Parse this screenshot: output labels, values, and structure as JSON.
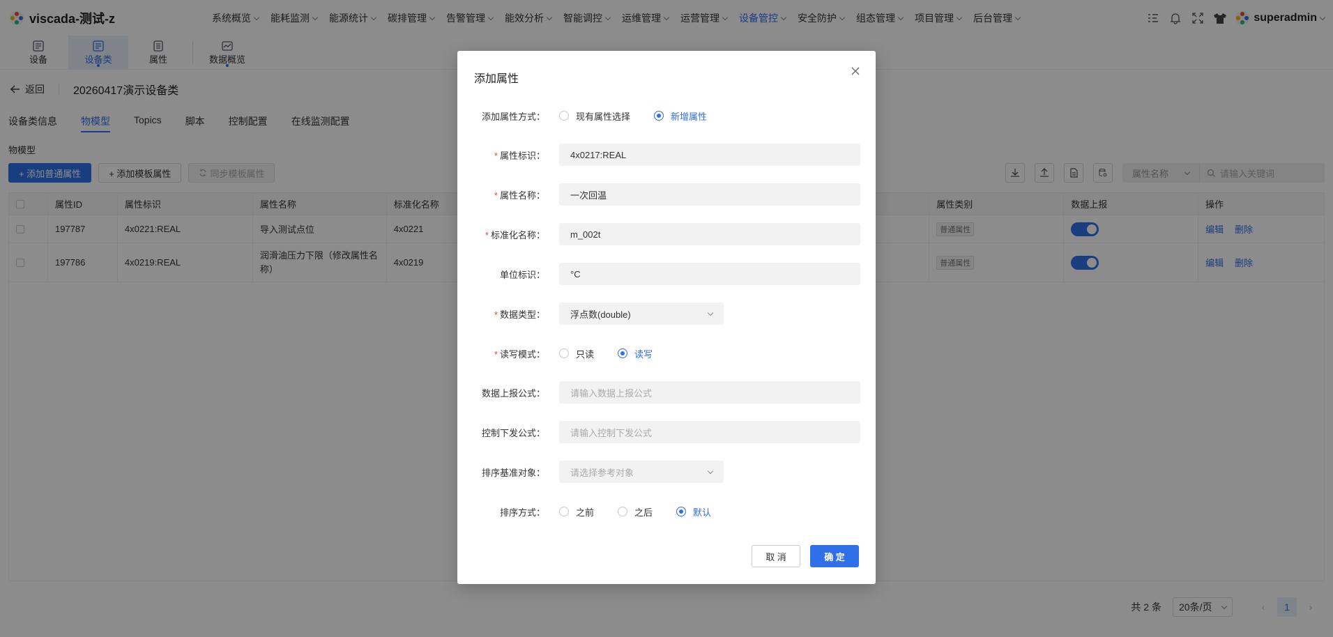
{
  "app": {
    "title": "viscada-测试-z"
  },
  "topnav": [
    {
      "label": "系统概览"
    },
    {
      "label": "能耗监测"
    },
    {
      "label": "能源统计"
    },
    {
      "label": "碳排管理"
    },
    {
      "label": "告警管理"
    },
    {
      "label": "能效分析"
    },
    {
      "label": "智能调控"
    },
    {
      "label": "运维管理"
    },
    {
      "label": "运营管理"
    },
    {
      "label": "设备管控"
    },
    {
      "label": "安全防护"
    },
    {
      "label": "组态管理"
    },
    {
      "label": "项目管理"
    },
    {
      "label": "后台管理"
    }
  ],
  "topnav_active": "设备管控",
  "user": {
    "name": "superadmin"
  },
  "subnav": [
    {
      "label": "设备"
    },
    {
      "label": "设备类"
    },
    {
      "label": "属性"
    },
    {
      "label": "数据概览"
    }
  ],
  "breadcrumb": {
    "back": "返回",
    "title": "20260417演示设备类"
  },
  "tabs": [
    {
      "label": "设备类信息"
    },
    {
      "label": "物模型"
    },
    {
      "label": "Topics"
    },
    {
      "label": "脚本"
    },
    {
      "label": "控制配置"
    },
    {
      "label": "在线监测配置"
    }
  ],
  "section_title": "物模型",
  "toolbar": {
    "add_normal": "+ 添加普通属性",
    "add_template": "+ 添加模板属性",
    "sync_template": "同步模板属性",
    "filter_select": "属性名称",
    "search_placeholder": "请输入关键词"
  },
  "table": {
    "headers": {
      "id": "属性ID",
      "ident": "属性标识",
      "name": "属性名称",
      "std": "标准化名称",
      "category": "属性类别",
      "report": "数据上报",
      "ops": "操作"
    },
    "rows": [
      {
        "id": "197787",
        "ident": "4x0221:REAL",
        "name": "导入测试点位",
        "std": "4x0221",
        "category": "普通属性",
        "report": true,
        "edit": "编辑",
        "del": "删除"
      },
      {
        "id": "197786",
        "ident": "4x0219:REAL",
        "name": "润滑油压力下限（修改属性名称）",
        "std": "4x0219",
        "category": "普通属性",
        "report": true,
        "edit": "编辑",
        "del": "删除"
      }
    ]
  },
  "pagination": {
    "total": "共 2 条",
    "page_size": "20条/页",
    "current": "1"
  },
  "modal": {
    "title": "添加属性",
    "fields": {
      "mode": {
        "label": "添加属性方式：",
        "options": [
          "现有属性选择",
          "新增属性"
        ],
        "selected": 1
      },
      "ident": {
        "label": "属性标识：",
        "value": "4x0217:REAL",
        "required": true
      },
      "name": {
        "label": "属性名称：",
        "value": "一次回温",
        "required": true
      },
      "std_name": {
        "label": "标准化名称：",
        "value": "m_002t",
        "required": true
      },
      "unit": {
        "label": "单位标识：",
        "value": "°C"
      },
      "data_type": {
        "label": "数据类型：",
        "value": "浮点数(double)",
        "required": true
      },
      "rw_mode": {
        "label": "读写模式：",
        "options": [
          "只读",
          "读写"
        ],
        "selected": 1,
        "required": true
      },
      "report_formula": {
        "label": "数据上报公式：",
        "placeholder": "请输入数据上报公式"
      },
      "control_formula": {
        "label": "控制下发公式：",
        "placeholder": "请输入控制下发公式"
      },
      "sort_ref": {
        "label": "排序基准对象：",
        "placeholder": "请选择参考对象"
      },
      "sort_mode": {
        "label": "排序方式：",
        "options": [
          "之前",
          "之后",
          "默认"
        ],
        "selected": 2
      }
    },
    "cancel": "取 消",
    "ok": "确 定"
  },
  "colors": {
    "primary": "#2f6fe8",
    "required": "#e54545"
  }
}
